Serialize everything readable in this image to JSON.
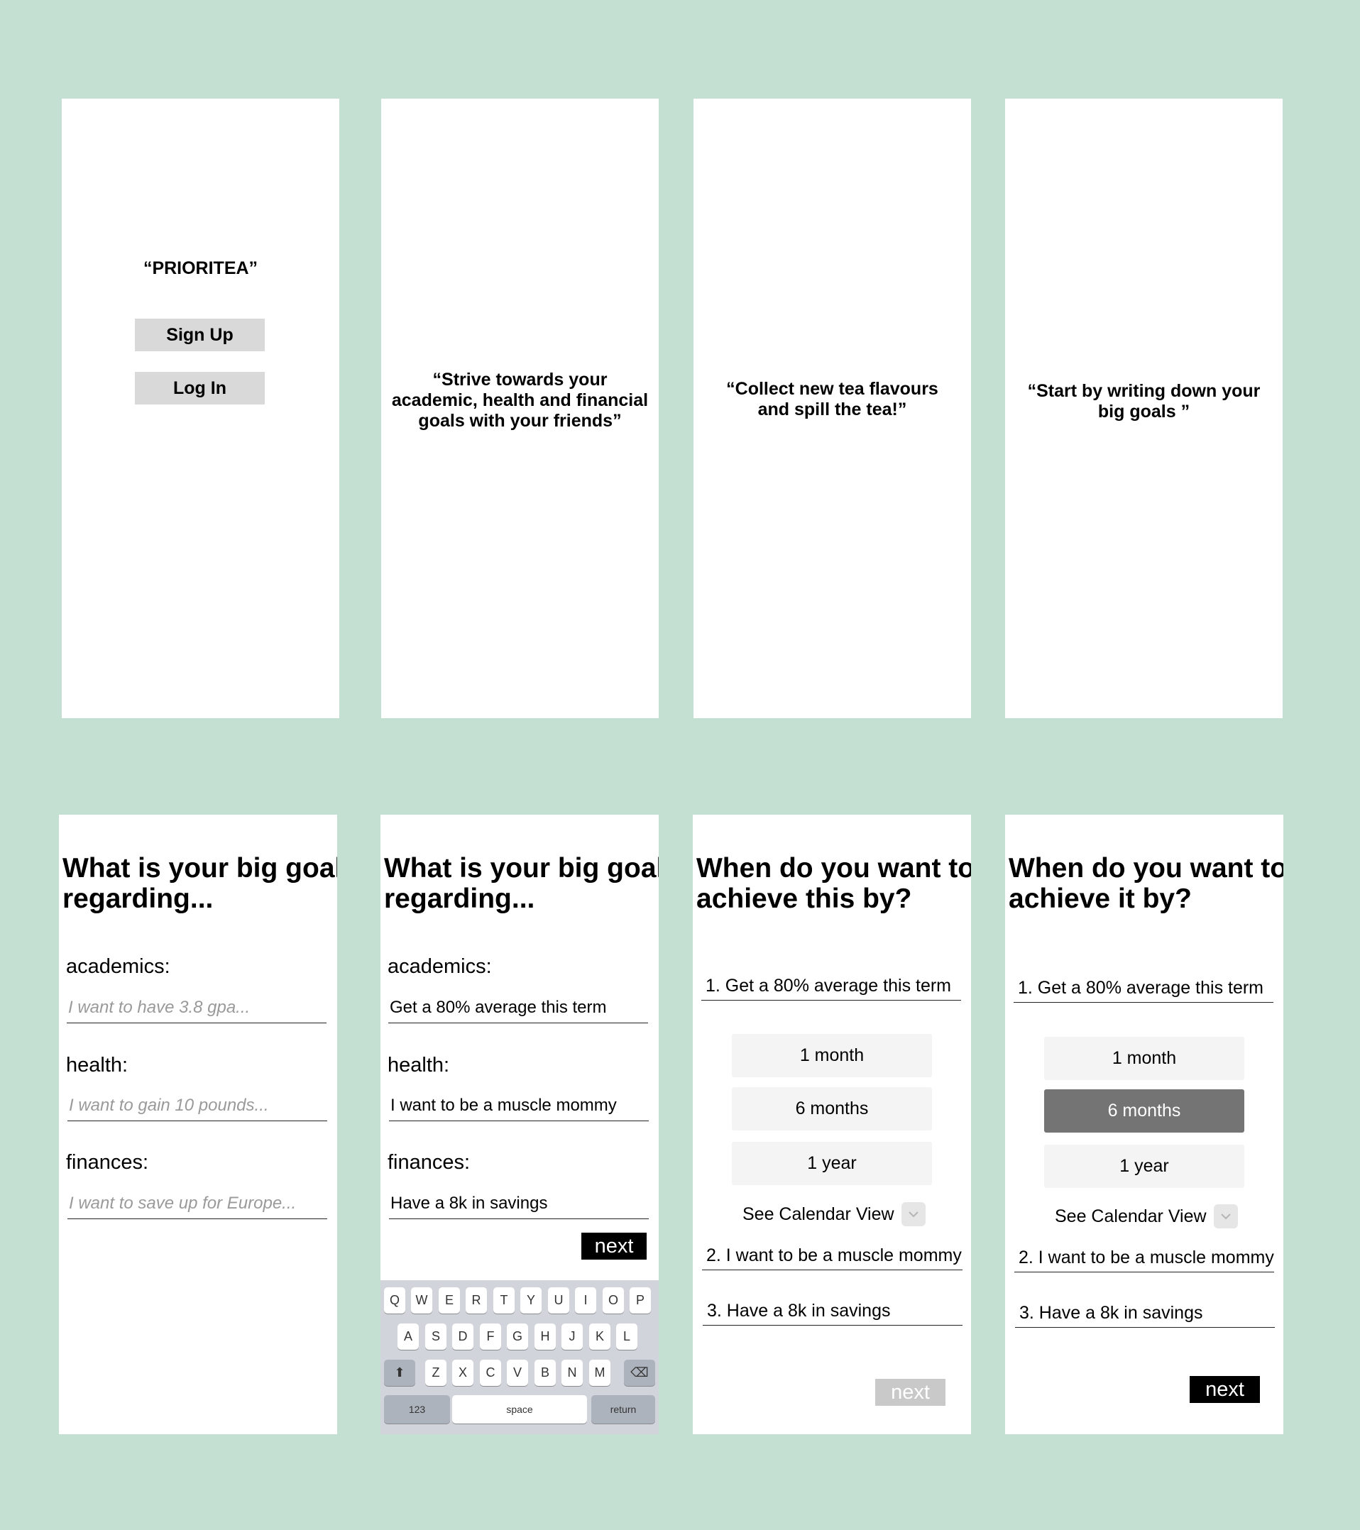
{
  "screen1": {
    "app_name": "“PRIORITEA”",
    "signup_label": "Sign Up",
    "login_label": "Log In"
  },
  "screen2": {
    "quote_lines": [
      "“Strive towards your",
      "academic, health and financial",
      "goals with your friends”"
    ]
  },
  "screen3": {
    "quote_lines": [
      "“Collect new tea flavours",
      "and spill the tea!”"
    ]
  },
  "screen4": {
    "quote_lines": [
      "“Start by writing down your",
      "big goals ”"
    ]
  },
  "screen5": {
    "heading_lines": [
      "What is your big goal",
      "regarding..."
    ],
    "academics_label": "academics:",
    "academics_placeholder": "I want to have 3.8 gpa...",
    "health_label": "health:",
    "health_placeholder": "I want to gain 10 pounds...",
    "finances_label": "finances:",
    "finances_placeholder": "I want to save up for Europe..."
  },
  "screen6": {
    "heading_lines": [
      "What is your big goal",
      "regarding..."
    ],
    "academics_label": "academics:",
    "academics_value": "Get a 80% average this term",
    "health_label": "health:",
    "health_value": "I want to be a muscle mommy",
    "finances_label": "finances:",
    "finances_value": "Have a 8k in savings",
    "next_label": "next",
    "keyboard": {
      "row1": [
        "Q",
        "W",
        "E",
        "R",
        "T",
        "Y",
        "U",
        "I",
        "O",
        "P"
      ],
      "row2": [
        "A",
        "S",
        "D",
        "F",
        "G",
        "H",
        "J",
        "K",
        "L"
      ],
      "row3": [
        "Z",
        "X",
        "C",
        "V",
        "B",
        "N",
        "M"
      ],
      "shift": "⬆",
      "delete": "⌫",
      "numbers": "123",
      "space": "space",
      "return": "return"
    }
  },
  "screen7": {
    "heading_lines": [
      "When do you want to",
      "achieve this by?"
    ],
    "goal1": "1. Get a 80% average this term",
    "options": [
      "1 month",
      "6 months",
      "1 year"
    ],
    "calendar_label": "See Calendar View",
    "goal2": "2. I want to be a muscle mommy",
    "goal3": "3. Have a 8k in savings",
    "next_label": "next"
  },
  "screen8": {
    "heading_lines": [
      "When do you want to",
      "achieve it by?"
    ],
    "goal1": "1. Get a 80% average this term",
    "options": [
      "1 month",
      "6 months",
      "1 year"
    ],
    "selected_option": "6 months",
    "calendar_label": "See Calendar View",
    "goal2": "2. I want to be a muscle mommy",
    "goal3": "3. Have a 8k in savings",
    "next_label": "next"
  },
  "colors": {
    "background": "#c4e0d3",
    "button_gray": "#d9d9d9",
    "selected_option": "#747474",
    "disabled_next": "#c9c9c9"
  }
}
